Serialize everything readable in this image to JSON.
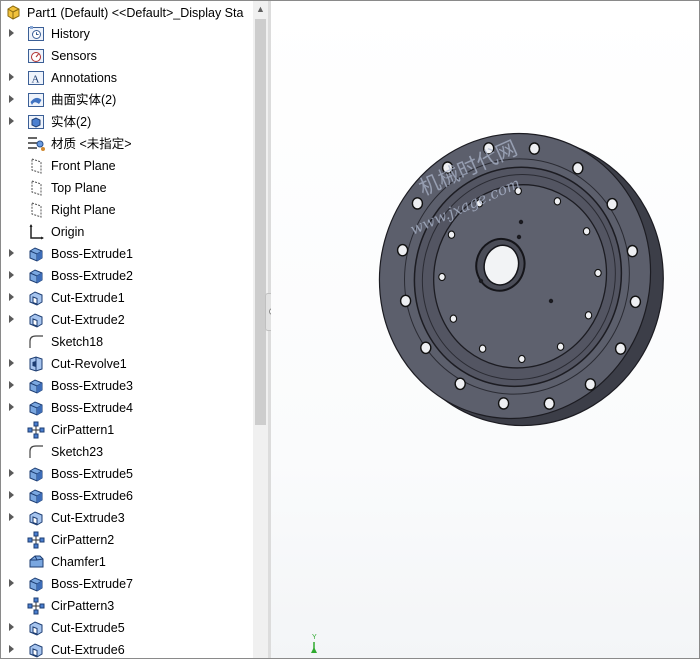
{
  "tree": {
    "title": "Part1  (Default) <<Default>_Display Sta",
    "items": [
      {
        "label": "History",
        "icon": "history-icon",
        "expander": true
      },
      {
        "label": "Sensors",
        "icon": "sensors-icon",
        "expander": false
      },
      {
        "label": "Annotations",
        "icon": "annotations-icon",
        "expander": true
      },
      {
        "label": "曲面实体(2)",
        "icon": "surface-bodies-icon",
        "expander": true
      },
      {
        "label": "实体(2)",
        "icon": "solid-bodies-icon",
        "expander": true
      },
      {
        "label": "材质 <未指定>",
        "icon": "material-icon",
        "expander": false
      },
      {
        "label": "Front Plane",
        "icon": "plane-icon",
        "expander": false
      },
      {
        "label": "Top Plane",
        "icon": "plane-icon",
        "expander": false
      },
      {
        "label": "Right Plane",
        "icon": "plane-icon",
        "expander": false
      },
      {
        "label": "Origin",
        "icon": "origin-icon",
        "expander": false
      },
      {
        "label": "Boss-Extrude1",
        "icon": "boss-extrude-icon",
        "expander": true
      },
      {
        "label": "Boss-Extrude2",
        "icon": "boss-extrude-icon",
        "expander": true
      },
      {
        "label": "Cut-Extrude1",
        "icon": "cut-extrude-icon",
        "expander": true
      },
      {
        "label": "Cut-Extrude2",
        "icon": "cut-extrude-icon",
        "expander": true
      },
      {
        "label": "Sketch18",
        "icon": "sketch-icon",
        "expander": false
      },
      {
        "label": "Cut-Revolve1",
        "icon": "cut-revolve-icon",
        "expander": true
      },
      {
        "label": "Boss-Extrude3",
        "icon": "boss-extrude-icon",
        "expander": true
      },
      {
        "label": "Boss-Extrude4",
        "icon": "boss-extrude-icon",
        "expander": true
      },
      {
        "label": "CirPattern1",
        "icon": "circular-pattern-icon",
        "expander": false
      },
      {
        "label": "Sketch23",
        "icon": "sketch-icon",
        "expander": false
      },
      {
        "label": "Boss-Extrude5",
        "icon": "boss-extrude-icon",
        "expander": true
      },
      {
        "label": "Boss-Extrude6",
        "icon": "boss-extrude-icon",
        "expander": true
      },
      {
        "label": "Cut-Extrude3",
        "icon": "cut-extrude-icon",
        "expander": true
      },
      {
        "label": "CirPattern2",
        "icon": "circular-pattern-icon",
        "expander": false
      },
      {
        "label": "Chamfer1",
        "icon": "chamfer-icon",
        "expander": false
      },
      {
        "label": "Boss-Extrude7",
        "icon": "boss-extrude-icon",
        "expander": true
      },
      {
        "label": "CirPattern3",
        "icon": "circular-pattern-icon",
        "expander": false
      },
      {
        "label": "Cut-Extrude5",
        "icon": "cut-extrude-icon",
        "expander": true
      },
      {
        "label": "Cut-Extrude6",
        "icon": "cut-extrude-icon",
        "expander": true
      }
    ]
  },
  "viewport": {
    "watermark_line1": "机械时代网",
    "watermark_line2": "www.jxage.com",
    "triad_y_label": "Y",
    "part_color": "#5c5f6c",
    "accent_color": "#1a4fa0"
  }
}
